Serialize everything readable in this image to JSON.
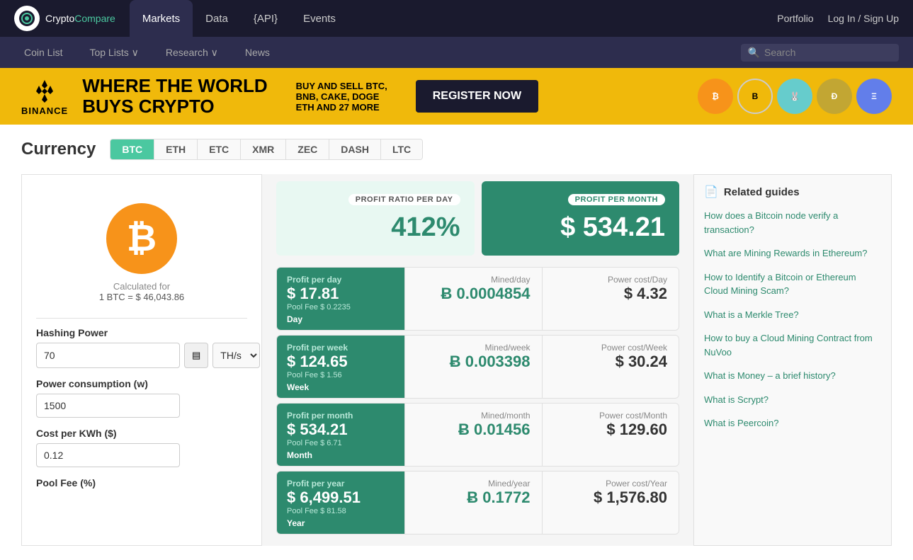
{
  "logo": {
    "crypto": "Crypto",
    "compare": "Compare",
    "icon_label": "CC"
  },
  "top_nav": {
    "tabs": [
      {
        "label": "Markets",
        "active": true
      },
      {
        "label": "Data",
        "active": false
      },
      {
        "label": "{API}",
        "active": false
      },
      {
        "label": "Events",
        "active": false
      }
    ],
    "right": [
      {
        "label": "Portfolio"
      },
      {
        "label": "Log In / Sign Up"
      }
    ]
  },
  "secondary_nav": {
    "items": [
      {
        "label": "Coin List"
      },
      {
        "label": "Top Lists ∨"
      },
      {
        "label": "Research ∨"
      },
      {
        "label": "News"
      }
    ],
    "search_placeholder": "Search"
  },
  "banner": {
    "brand": "BINANCE",
    "headline_line1": "WHERE THE WORLD",
    "headline_line2": "BUYS CRYPTO",
    "sub_line1": "BUY AND SELL BTC,",
    "sub_line2": "BNB, CAKE, DOGE",
    "sub_line3": "ETH AND 27 MORE",
    "cta": "REGISTER NOW"
  },
  "currency": {
    "title": "Currency",
    "tabs": [
      "BTC",
      "ETH",
      "ETC",
      "XMR",
      "ZEC",
      "DASH",
      "LTC"
    ],
    "active_tab": "BTC"
  },
  "calculator": {
    "icon_symbol": "₿",
    "calc_for_label": "Calculated for",
    "rate_label": "1 BTC = $ 46,043.86",
    "hashing_power": {
      "label": "Hashing Power",
      "value": "70",
      "unit": "TH/s"
    },
    "power_consumption": {
      "label": "Power consumption (w)",
      "value": "1500"
    },
    "cost_per_kwh": {
      "label": "Cost per KWh ($)",
      "value": "0.12"
    },
    "pool_fee": {
      "label": "Pool Fee (%)"
    }
  },
  "profit_summary": {
    "day": {
      "label": "PROFIT RATIO PER DAY",
      "value": "412%"
    },
    "month": {
      "label": "PROFIT PER MONTH",
      "value": "$ 534.21"
    }
  },
  "profit_rows": [
    {
      "period": "Day",
      "period_label": "Profit per day",
      "profit": "$ 17.81",
      "pool_fee": "Pool Fee $ 0.2235",
      "mined_label": "Mined/day",
      "mined_value": "Ƀ 0.0004854",
      "power_label": "Power cost/Day",
      "power_value": "$ 4.32"
    },
    {
      "period": "Week",
      "period_label": "Profit per week",
      "profit": "$ 124.65",
      "pool_fee": "Pool Fee $ 1.56",
      "mined_label": "Mined/week",
      "mined_value": "Ƀ 0.003398",
      "power_label": "Power cost/Week",
      "power_value": "$ 30.24"
    },
    {
      "period": "Month",
      "period_label": "Profit per month",
      "profit": "$ 534.21",
      "pool_fee": "Pool Fee $ 6.71",
      "mined_label": "Mined/month",
      "mined_value": "Ƀ 0.01456",
      "power_label": "Power cost/Month",
      "power_value": "$ 129.60"
    },
    {
      "period": "Year",
      "period_label": "Profit per year",
      "profit": "$ 6,499.51",
      "pool_fee": "Pool Fee $ 81.58",
      "mined_label": "Mined/year",
      "mined_value": "Ƀ 0.1772",
      "power_label": "Power cost/Year",
      "power_value": "$ 1,576.80"
    }
  ],
  "related_guides": {
    "title": "Related guides",
    "links": [
      {
        "text": "How does a Bitcoin node verify a transaction?"
      },
      {
        "text": "What are Mining Rewards in Ethereum?"
      },
      {
        "text": "How to Identify a Bitcoin or Ethereum Cloud Mining Scam?"
      },
      {
        "text": "What is a Merkle Tree?"
      },
      {
        "text": "How to buy a Cloud Mining Contract from NuVoo"
      },
      {
        "text": "What is Money – a brief history?"
      },
      {
        "text": "What is Scrypt?"
      },
      {
        "text": "What is Peercoin?"
      }
    ]
  }
}
